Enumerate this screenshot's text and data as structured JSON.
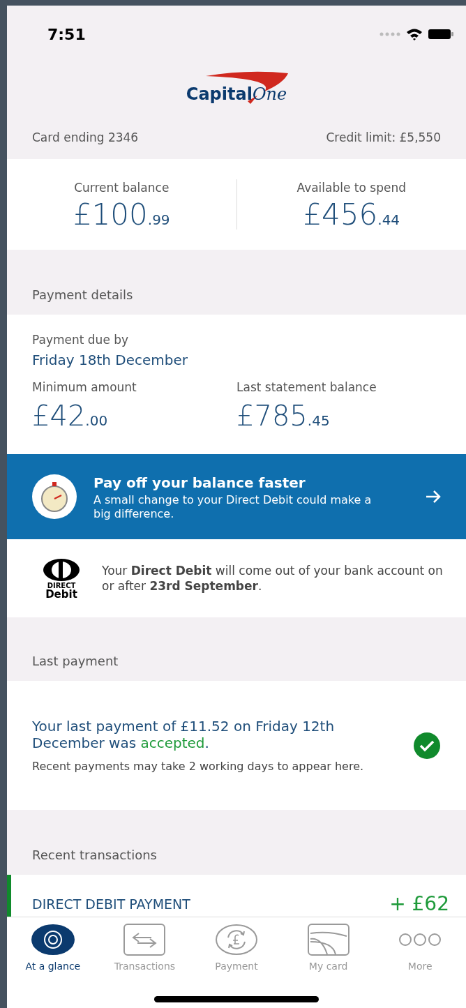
{
  "status_bar": {
    "time": "7:51"
  },
  "header": {
    "logo_word_1": "Capital",
    "logo_word_2": "One",
    "card_ending": "Card ending 2346",
    "credit_limit": "Credit limit: £5,550"
  },
  "balances": [
    {
      "label": "Current balance",
      "amount": "£100",
      "pence": ".99"
    },
    {
      "label": "Available to spend",
      "amount": "£456",
      "pence": ".44"
    }
  ],
  "payment_details": {
    "heading": "Payment details",
    "due_label": "Payment due by",
    "due_date": "Friday 18th December",
    "amounts": [
      {
        "label": "Minimum amount",
        "amount": "£42",
        "pence": ".00"
      },
      {
        "label": "Last statement balance",
        "amount": "£785",
        "pence": ".45"
      }
    ]
  },
  "banner": {
    "title": "Pay off your balance faster",
    "text": "A small change to your Direct Debit could make a big difference."
  },
  "direct_debit": {
    "logo_top": "DIRECT",
    "logo_bottom": "Debit",
    "text": "Your **Direct Debit** will come out of your bank account on or after **23rd September**."
  },
  "last_payment": {
    "heading": "Last payment",
    "text_before": "Your last payment of £11.52 on Friday 12th December was ",
    "status": "accepted",
    "text_after": ".",
    "note": "Recent payments may take 2 working days to appear here.",
    "accepted": true
  },
  "recent_transactions": {
    "heading": "Recent transactions",
    "rows": [
      {
        "description": "DIRECT DEBIT PAYMENT",
        "amount": "+ £62",
        "credit": true
      }
    ]
  },
  "tab_bar": [
    {
      "kind": "glance",
      "label": "At a glance",
      "selected": true
    },
    {
      "kind": "transactions",
      "label": "Transactions",
      "selected": false
    },
    {
      "kind": "payment",
      "label": "Payment",
      "selected": false
    },
    {
      "kind": "card",
      "label": "My card",
      "selected": false
    },
    {
      "kind": "more",
      "label": "More",
      "selected": false
    }
  ]
}
